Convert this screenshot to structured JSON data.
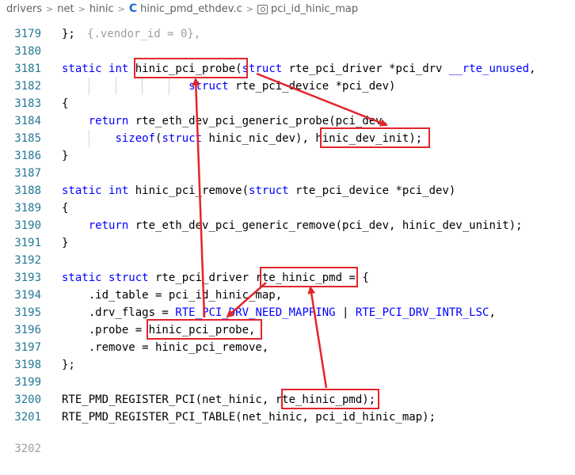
{
  "breadcrumb": {
    "items": [
      "drivers",
      "net",
      "hinic",
      "hinic_pmd_ethdev.c",
      "pci_id_hinic_map"
    ],
    "separator": ">"
  },
  "editor": {
    "lines": [
      {
        "n": "3179",
        "code": "};"
      },
      {
        "n": "3180",
        "code": ""
      },
      {
        "n": "3181",
        "code": "static int hinic_pci_probe(struct rte_pci_driver *pci_drv __rte_unused,"
      },
      {
        "n": "3182",
        "code": "                   struct rte_pci_device *pci_dev)"
      },
      {
        "n": "3183",
        "code": "{"
      },
      {
        "n": "3184",
        "code": "    return rte_eth_dev_pci_generic_probe(pci_dev,"
      },
      {
        "n": "3185",
        "code": "        sizeof(struct hinic_nic_dev), hinic_dev_init);"
      },
      {
        "n": "3186",
        "code": "}"
      },
      {
        "n": "3187",
        "code": ""
      },
      {
        "n": "3188",
        "code": "static int hinic_pci_remove(struct rte_pci_device *pci_dev)"
      },
      {
        "n": "3189",
        "code": "{"
      },
      {
        "n": "3190",
        "code": "    return rte_eth_dev_pci_generic_remove(pci_dev, hinic_dev_uninit);"
      },
      {
        "n": "3191",
        "code": "}"
      },
      {
        "n": "3192",
        "code": ""
      },
      {
        "n": "3193",
        "code": "static struct rte_pci_driver rte_hinic_pmd = {"
      },
      {
        "n": "3194",
        "code": "    .id_table = pci_id_hinic_map,"
      },
      {
        "n": "3195",
        "code": "    .drv_flags = RTE_PCI_DRV_NEED_MAPPING | RTE_PCI_DRV_INTR_LSC,"
      },
      {
        "n": "3196",
        "code": "    .probe = hinic_pci_probe,"
      },
      {
        "n": "3197",
        "code": "    .remove = hinic_pci_remove,"
      },
      {
        "n": "3198",
        "code": "};"
      },
      {
        "n": "3199",
        "code": ""
      },
      {
        "n": "3200",
        "code": "RTE_PMD_REGISTER_PCI(net_hinic, rte_hinic_pmd);"
      },
      {
        "n": "3201",
        "code": "RTE_PMD_REGISTER_PCI_TABLE(net_hinic, pci_id_hinic_map);"
      }
    ],
    "keywords": [
      "static",
      "int",
      "struct",
      "return",
      "sizeof",
      "__rte_unused",
      "RTE_PCI_DRV_NEED_MAPPING",
      "RTE_PCI_DRV_INTR_LSC"
    ],
    "keyword_color": "#0000ff",
    "line_number_color": "#237893"
  },
  "annotations": {
    "highlight_color": "#e3242b"
  }
}
